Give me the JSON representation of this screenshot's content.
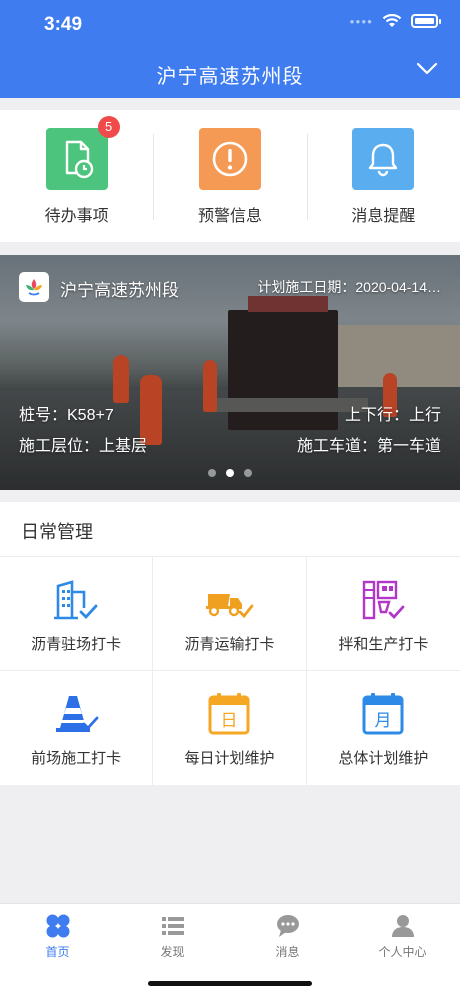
{
  "status_bar": {
    "time": "3:49"
  },
  "header": {
    "title": "沪宁高速苏州段"
  },
  "quick_actions": [
    {
      "label": "待办事项",
      "badge": "5",
      "color": "#4cc47d",
      "icon": "todo-document-clock-icon"
    },
    {
      "label": "预警信息",
      "color": "#f59a54",
      "icon": "warning-exclamation-icon"
    },
    {
      "label": "消息提醒",
      "color": "#5aaef0",
      "icon": "bell-icon"
    }
  ],
  "banner": {
    "project": "沪宁高速苏州段",
    "plan_date": "计划施工日期：2020-04-14…",
    "stake": "桩号：K58+7",
    "direction": "上下行：上行",
    "layer": "施工层位：上基层",
    "lane": "施工车道：第一车道",
    "slides": 3,
    "active_slide": 2
  },
  "daily": {
    "title": "日常管理",
    "items": [
      {
        "label": "沥青驻场打卡",
        "icon": "building-check-icon",
        "color": "#2d8ae6"
      },
      {
        "label": "沥青运输打卡",
        "icon": "dump-truck-check-icon",
        "color": "#f0a020"
      },
      {
        "label": "拌和生产打卡",
        "icon": "mixing-plant-check-icon",
        "color": "#b236c8"
      },
      {
        "label": "前场施工打卡",
        "icon": "traffic-cone-check-icon",
        "color": "#2d6fe6"
      },
      {
        "label": "每日计划维护",
        "icon": "calendar-day-icon",
        "glyph": "日",
        "color": "#f5a623"
      },
      {
        "label": "总体计划维护",
        "icon": "calendar-month-icon",
        "glyph": "月",
        "color": "#2d8ae6"
      }
    ]
  },
  "tabs": [
    {
      "label": "首页",
      "icon": "home-grid-icon",
      "active": true
    },
    {
      "label": "发现",
      "icon": "list-icon"
    },
    {
      "label": "消息",
      "icon": "chat-bubble-icon"
    },
    {
      "label": "个人中心",
      "icon": "person-icon"
    }
  ],
  "colors": {
    "primary": "#3e7cf0",
    "badge": "#f04a4a"
  }
}
